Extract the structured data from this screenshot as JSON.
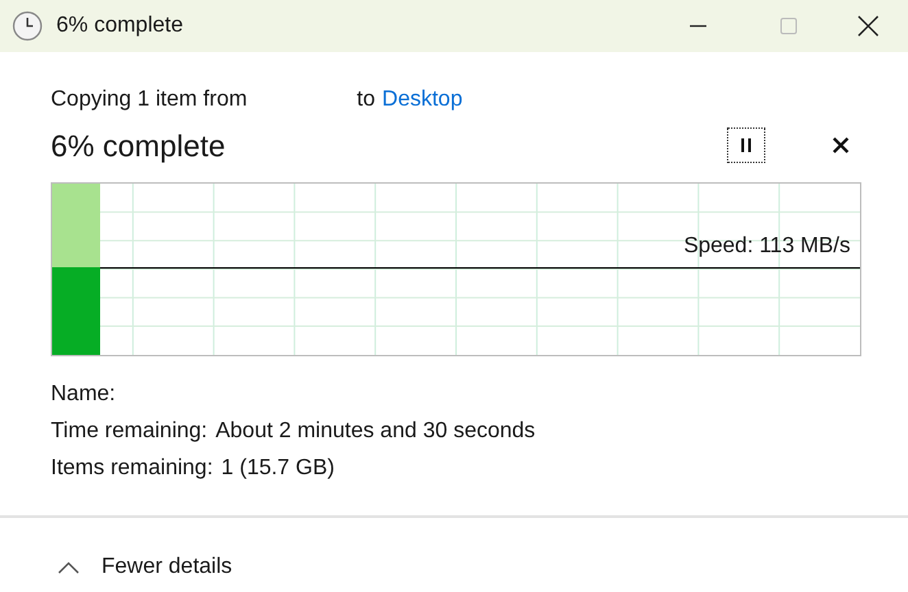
{
  "window": {
    "title": "6% complete"
  },
  "copying": {
    "prefix": "Copying 1 item from",
    "to": "to",
    "destination": "Desktop"
  },
  "heading": "6% complete",
  "progress": {
    "level": 0.06,
    "speed": "Speed: 113 MB/s"
  },
  "details": [
    {
      "label": "Name:"
    },
    {
      "label": "Time remaining:",
      "value": "About 2 minutes and 30 seconds"
    },
    {
      "label": "Items remaining:",
      "value": "1 (15.7 GB)"
    }
  ],
  "toggle": {
    "label": "Fewer details",
    "expanded": true
  }
}
